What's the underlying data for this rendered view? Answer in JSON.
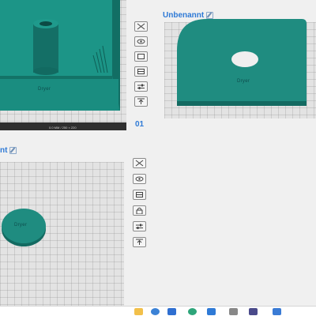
{
  "plates": {
    "plate01": {
      "number": "01",
      "scale_text": "0.0 MM / 250 × 220",
      "model_label": "Dryer"
    },
    "unbenannt_top": {
      "title": "Unbenannt",
      "model_label": "Dryer"
    },
    "unbenannt_bottom": {
      "title": "nt",
      "model_label": "Dryer"
    }
  },
  "toolbar_top": {
    "icons": [
      "close-icon",
      "eye-icon",
      "box-icon",
      "box-icon",
      "sliders-icon",
      "upload-icon"
    ]
  },
  "toolbar_bottom": {
    "icons": [
      "close-icon",
      "eye-icon",
      "box-icon",
      "lock-icon",
      "sliders-icon",
      "upload-icon"
    ]
  },
  "colors": {
    "model_teal": "#1f8c80",
    "model_dark": "#136a61",
    "accent_blue": "#2f7ad6"
  },
  "taskbar": {
    "icons": [
      "file-explorer-icon",
      "chrome-icon",
      "store-icon",
      "edge-icon",
      "cura-icon",
      "app-icon"
    ]
  }
}
